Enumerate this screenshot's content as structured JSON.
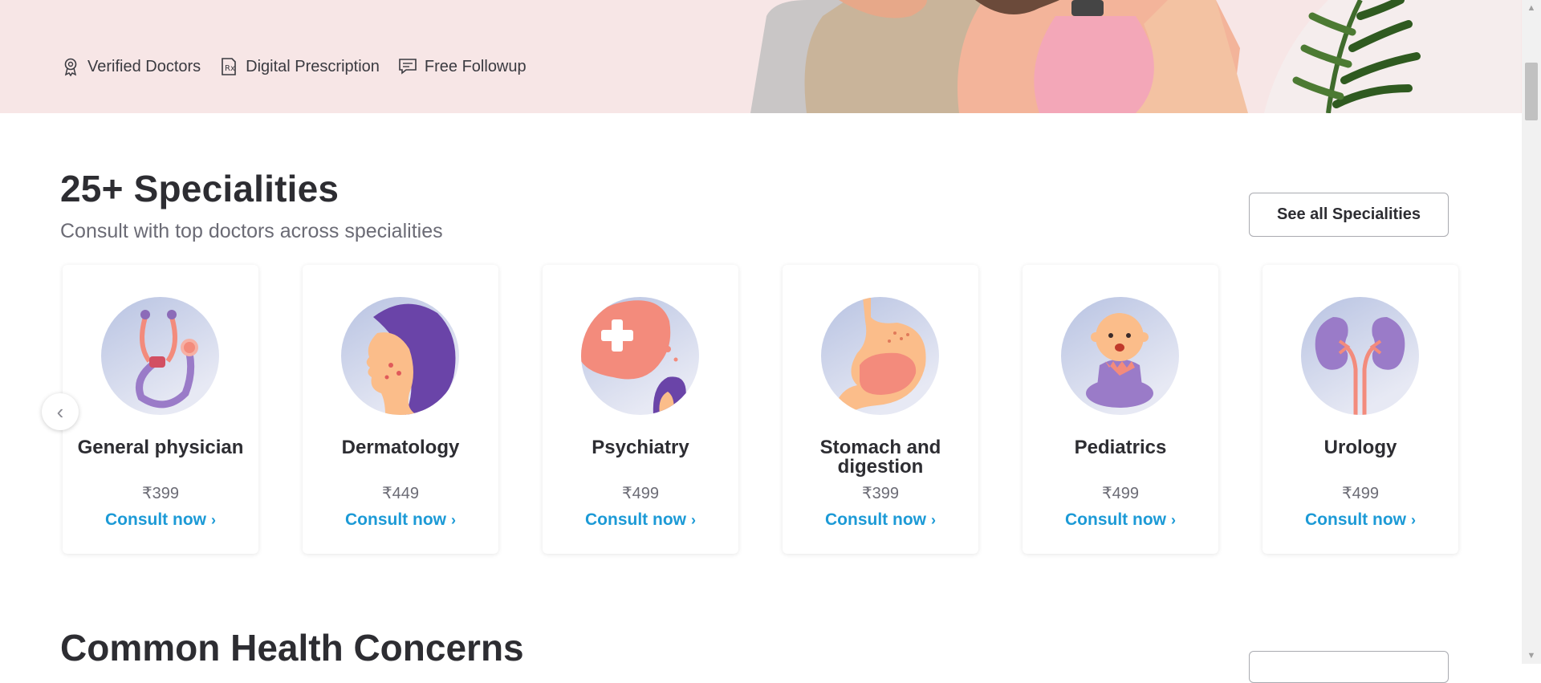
{
  "hero": {
    "features": [
      {
        "icon": "award-badge-icon",
        "label": "Verified Doctors"
      },
      {
        "icon": "prescription-icon",
        "label": "Digital Prescription"
      },
      {
        "icon": "chat-bubble-icon",
        "label": "Free Followup"
      }
    ]
  },
  "specialities": {
    "title": "25+ Specialities",
    "subtitle": "Consult with top doctors across specialities",
    "see_all_label": "See all Specialities",
    "cta_label": "Consult now",
    "items": [
      {
        "name": "General physician",
        "price": "₹399",
        "icon": "stethoscope-icon"
      },
      {
        "name": "Dermatology",
        "price": "₹449",
        "icon": "skin-face-icon"
      },
      {
        "name": "Psychiatry",
        "price": "₹499",
        "icon": "mental-health-icon"
      },
      {
        "name": "Stomach and digestion",
        "price": "₹399",
        "icon": "stomach-icon"
      },
      {
        "name": "Pediatrics",
        "price": "₹499",
        "icon": "baby-icon"
      },
      {
        "name": "Urology",
        "price": "₹499",
        "icon": "kidney-icon"
      }
    ]
  },
  "health_concerns": {
    "title": "Common Health Concerns"
  },
  "colors": {
    "accent": "#1c9ad6",
    "hero_bg": "#f7e6e6",
    "title": "#2d2d32",
    "muted": "#6b6b75"
  }
}
